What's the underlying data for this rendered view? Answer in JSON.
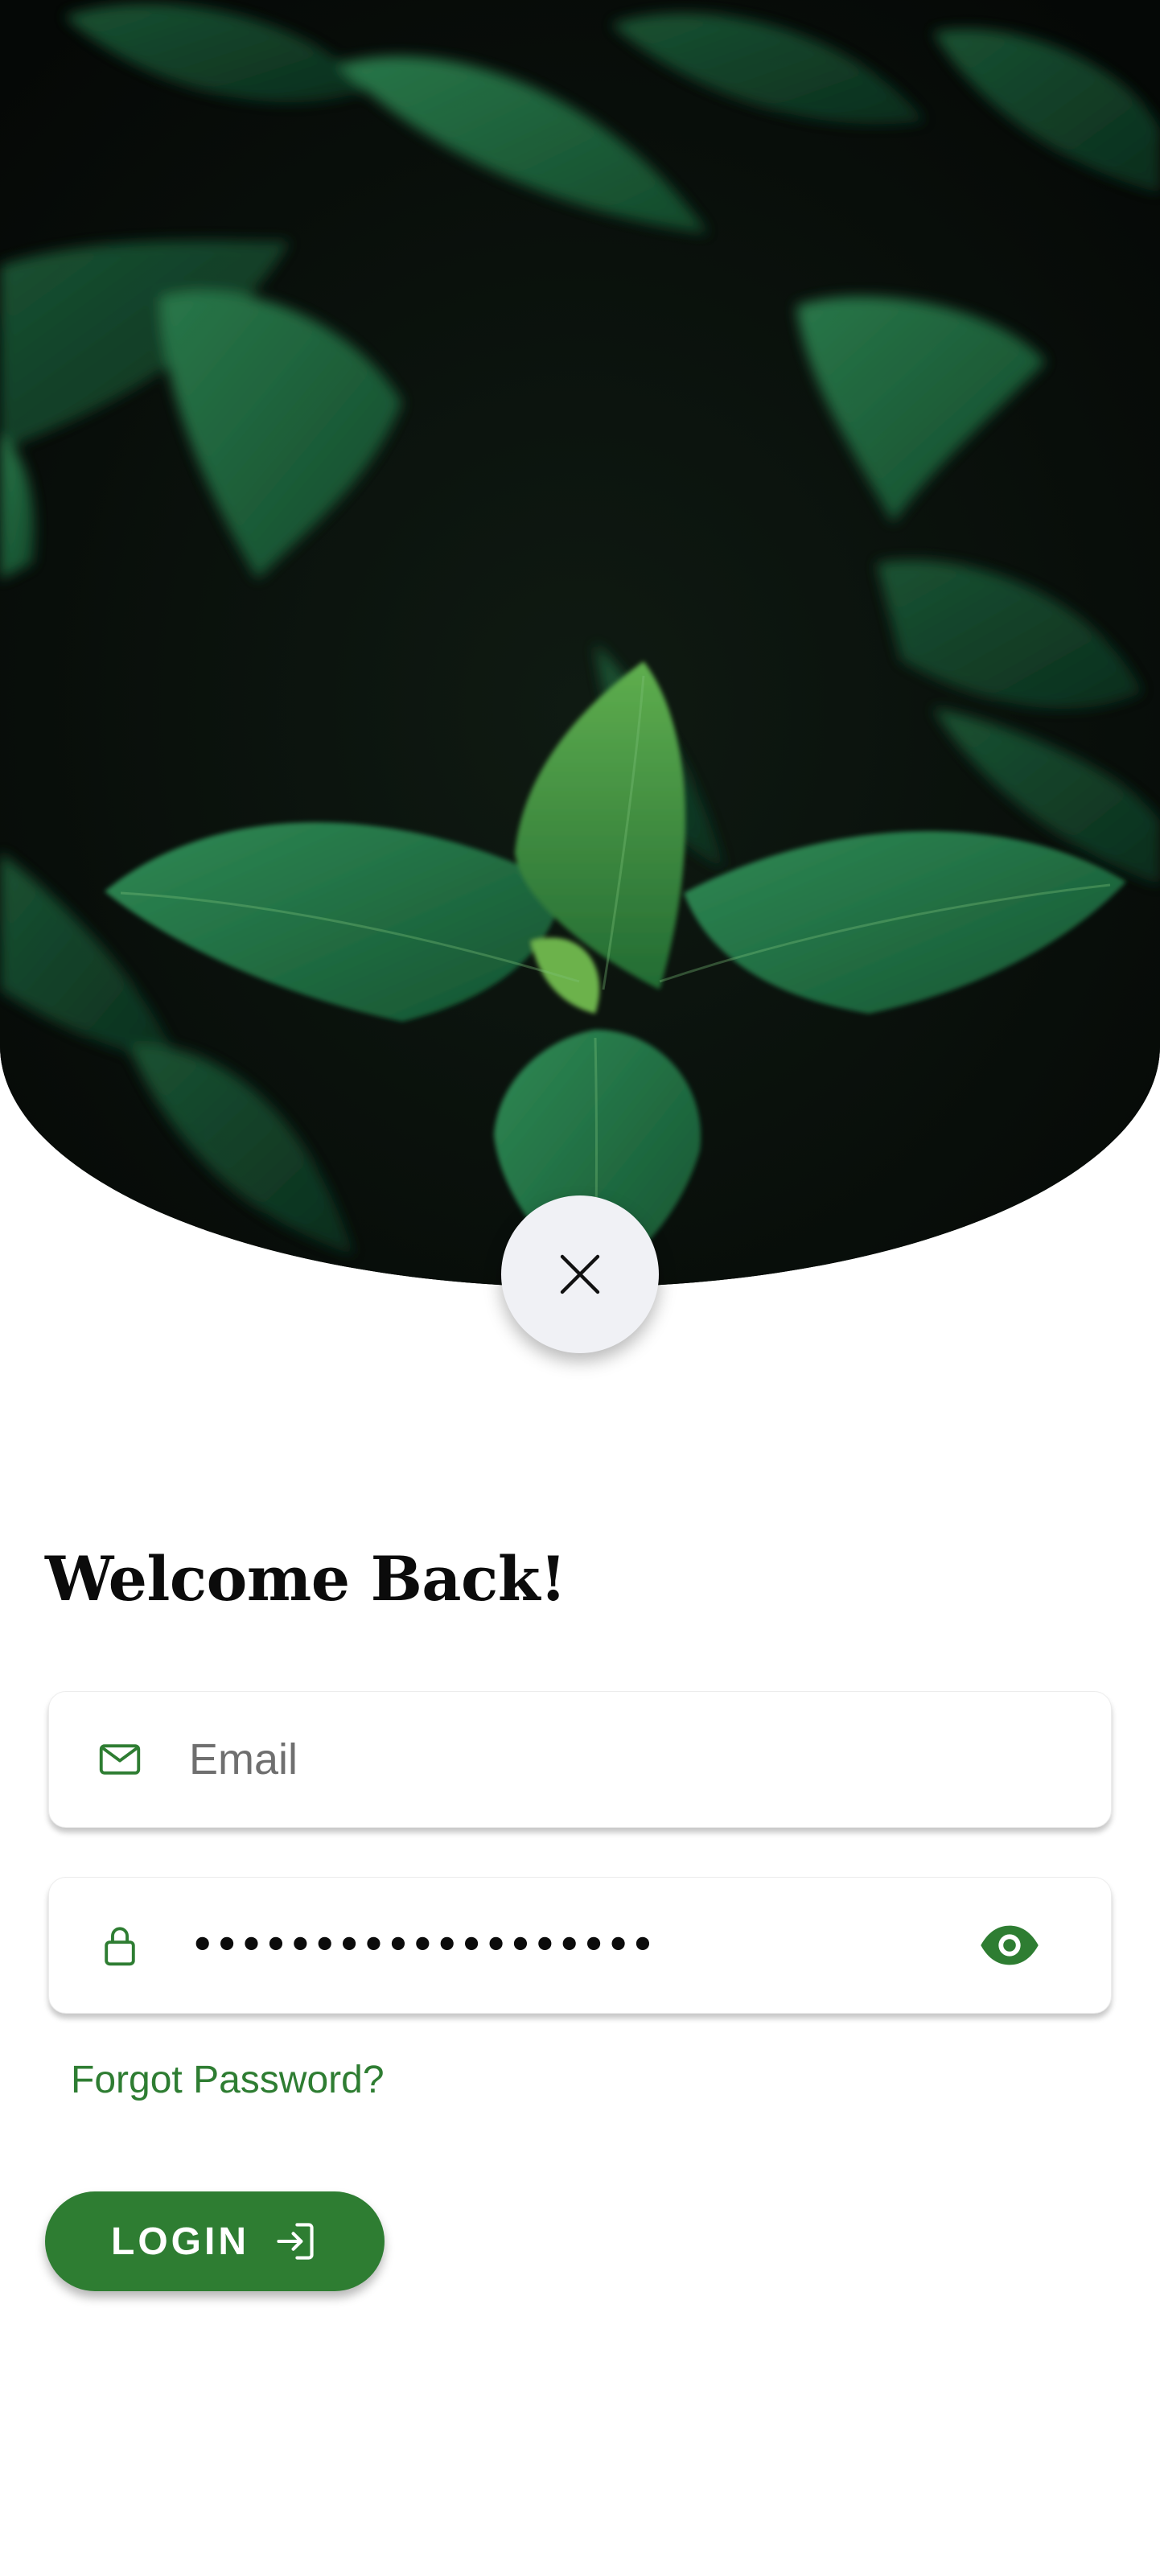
{
  "header": {
    "image": "dark green plant leaves photo"
  },
  "close_button": {
    "icon": "close-icon"
  },
  "welcome": {
    "title": "Welcome Back!"
  },
  "form": {
    "email": {
      "icon": "mail-icon",
      "placeholder": "Email",
      "value": ""
    },
    "password": {
      "icon": "lock-icon",
      "masked_value": "•••••••••••••••••••",
      "toggle_icon": "eye-icon"
    },
    "forgot_password_label": "Forgot Password?",
    "login_label": "LOGIN",
    "login_icon": "login-arrow-icon"
  },
  "colors": {
    "accent": "#2e7d32",
    "close_button_bg": "#f0f1f5",
    "title_text": "#0b0b0b"
  }
}
